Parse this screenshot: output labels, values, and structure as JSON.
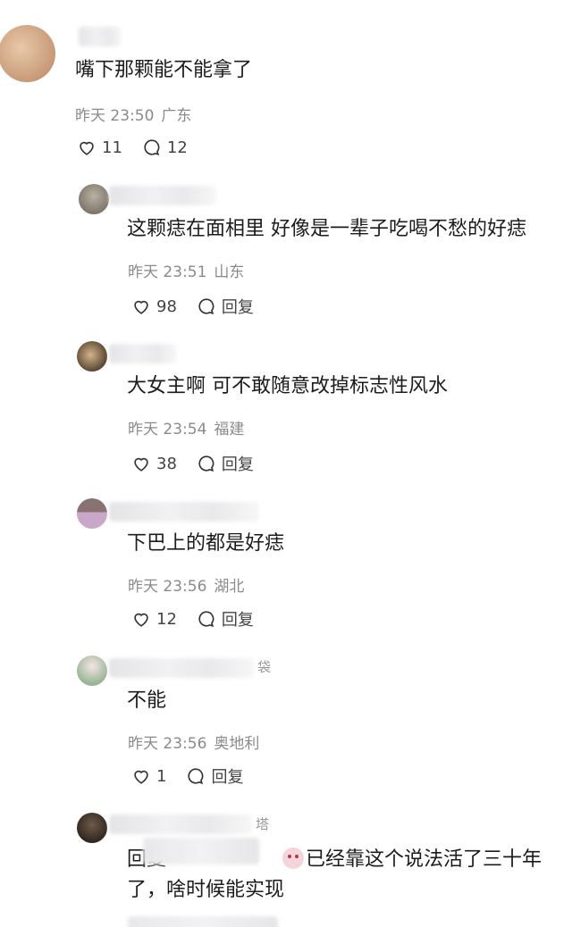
{
  "colors": {
    "heart": "#333333",
    "meta": "#8b8b8b",
    "text": "#1c1c1c"
  },
  "top_comment": {
    "text": "嘴下那颗能不能拿了",
    "time": "昨天 23:50",
    "location": "广东",
    "likes": "11",
    "replies": "12"
  },
  "replies": [
    {
      "name_fragment": "",
      "text": "这颗痣在面相里 好像是一辈子吃喝不愁的好痣",
      "time": "昨天 23:51",
      "location": "山东",
      "likes": "98",
      "reply_label": "回复"
    },
    {
      "name_fragment": "",
      "text": "大女主啊 可不敢随意改掉标志性风水",
      "time": "昨天 23:54",
      "location": "福建",
      "likes": "38",
      "reply_label": "回复"
    },
    {
      "name_fragment": "",
      "text": "下巴上的都是好痣",
      "time": "昨天 23:56",
      "location": "湖北",
      "likes": "12",
      "reply_label": "回复"
    },
    {
      "name_fragment": "袋",
      "text": "不能",
      "time": "昨天 23:56",
      "location": "奥地利",
      "likes": "1",
      "reply_label": "回复"
    },
    {
      "name_fragment": "塔",
      "text_prefix": "回复",
      "text_main": "已经靠这个说法活了三十年",
      "text_line2": "了，啥时候能实现",
      "time": "",
      "location": ""
    }
  ]
}
